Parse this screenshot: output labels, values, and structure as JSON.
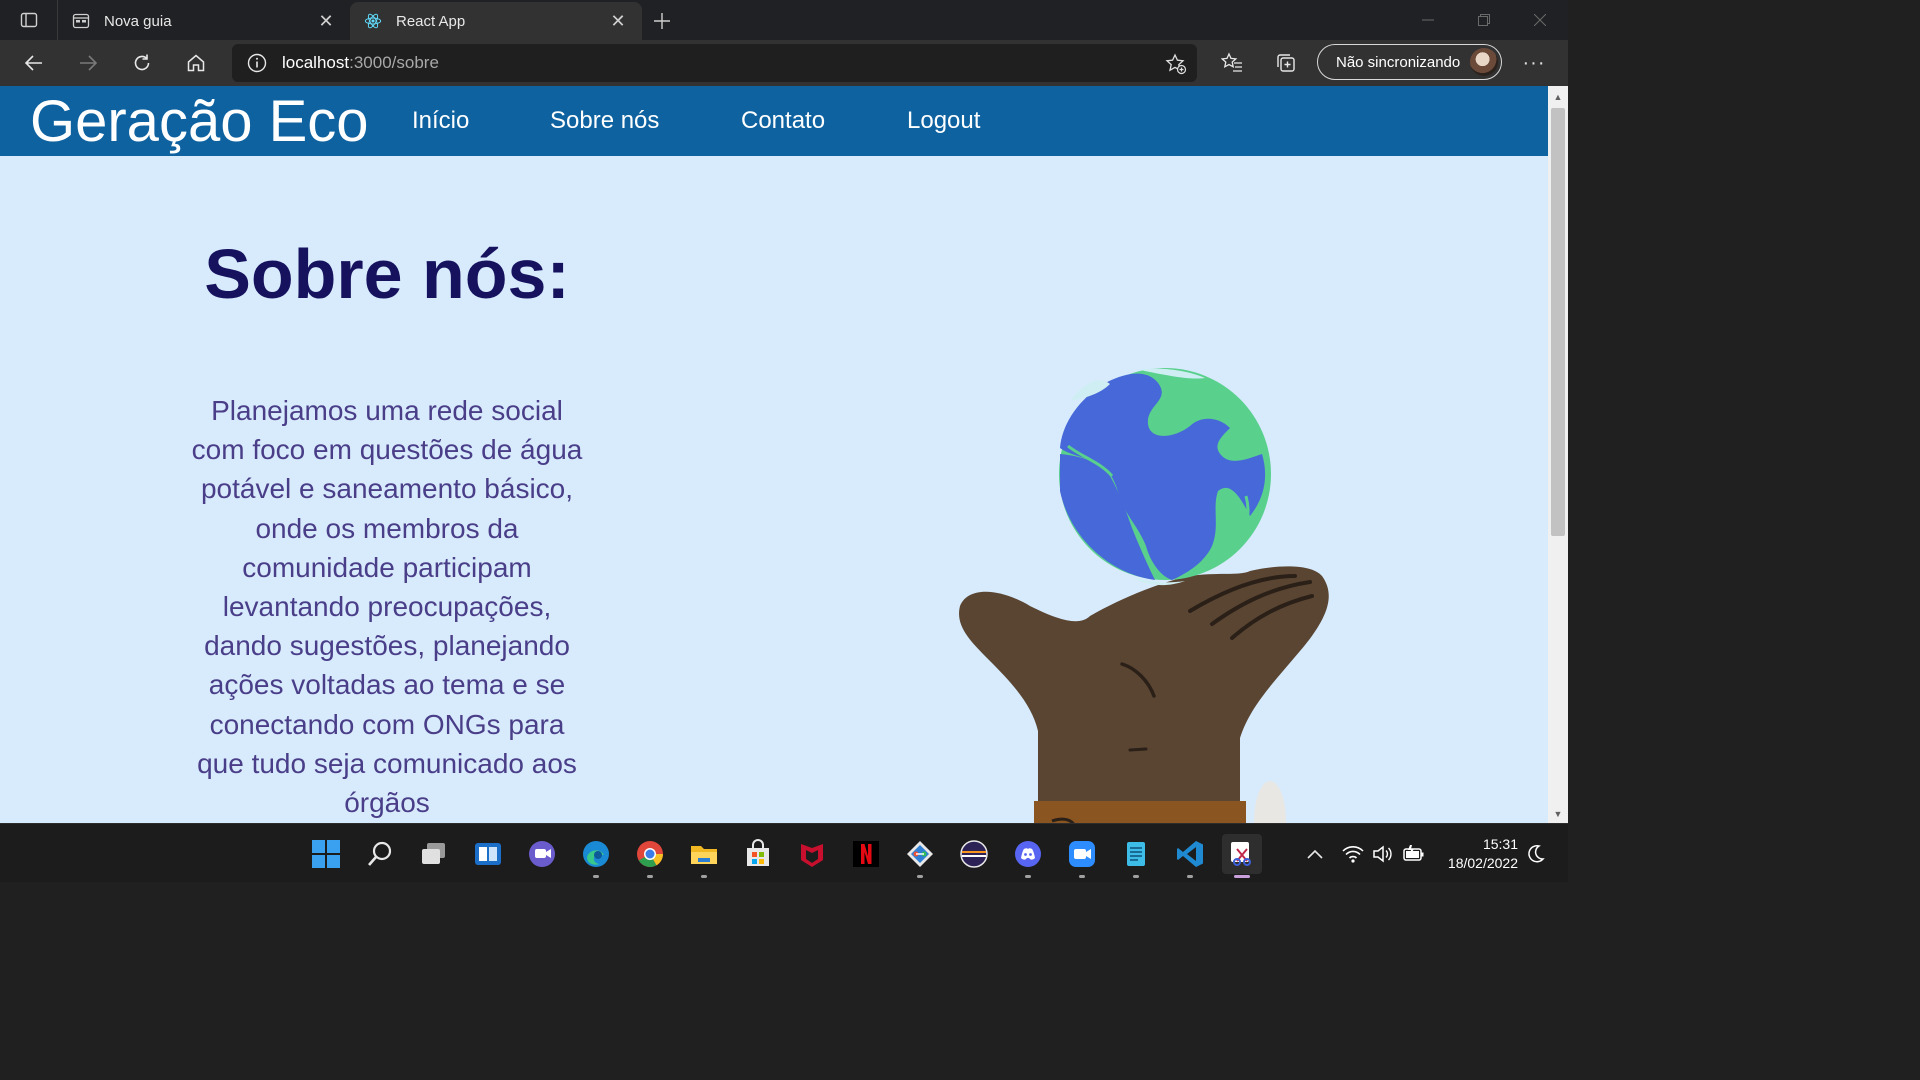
{
  "browser": {
    "tabs": [
      {
        "title": "Nova guia",
        "active": false
      },
      {
        "title": "React App",
        "active": true
      }
    ],
    "url_host": "localhost",
    "url_path": ":3000/sobre",
    "profile_label": "Não sincronizando"
  },
  "site": {
    "brand": "Geração Eco",
    "nav": [
      {
        "label": "Início"
      },
      {
        "label": "Sobre nós"
      },
      {
        "label": "Contato"
      },
      {
        "label": "Logout"
      }
    ],
    "about_title": "Sobre nós:",
    "about_text": "Planejamos uma rede social com foco em questões de água potável e saneamento básico, onde os membros da comunidade participam levantando preocupações, dando sugestões, planejando ações voltadas ao tema e se conectando com ONGs para que tudo seja comunicado aos órgãos"
  },
  "taskbar": {
    "apps": [
      "start-icon",
      "search-icon",
      "task-view-icon",
      "widgets-icon",
      "chat-icon",
      "edge-icon",
      "chrome-icon",
      "file-explorer-icon",
      "microsoft-store-icon",
      "mcafee-icon",
      "netflix-icon",
      "git-icon",
      "eclipse-icon",
      "discord-icon",
      "zoom-icon",
      "notepad-icon",
      "vscode-icon",
      "snipping-tool-icon"
    ],
    "time": "15:31",
    "date": "18/02/2022"
  },
  "colors": {
    "navbar": "#0e62a0",
    "page_bg": "#d7ebfd",
    "title": "#16125e",
    "text": "#4a3e88"
  }
}
